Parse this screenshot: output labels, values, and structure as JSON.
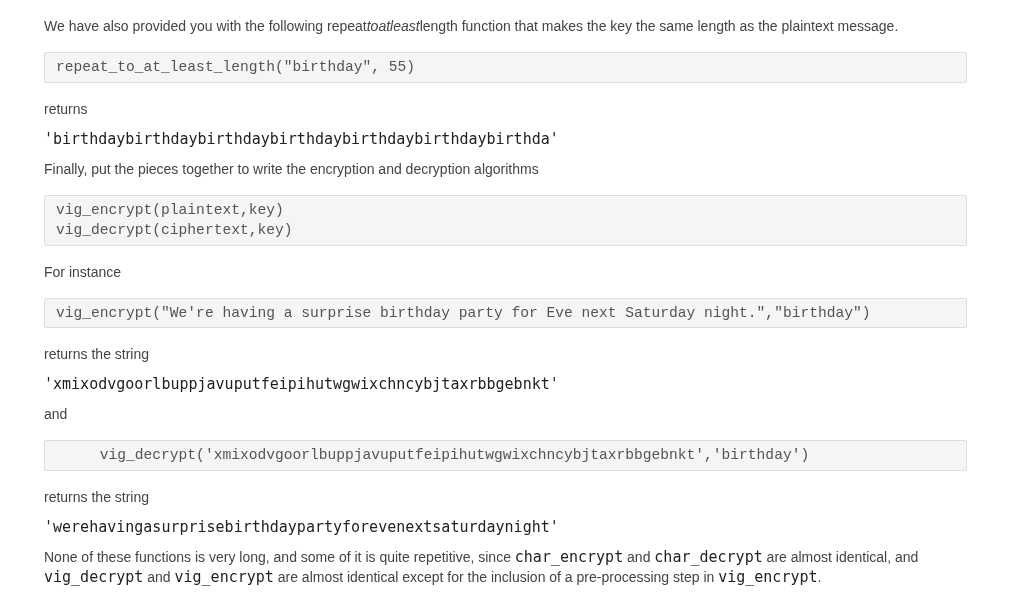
{
  "blocks": [
    {
      "kind": "paragraph",
      "segments": [
        {
          "kind": "text",
          "text": "We have also provided you with the following repeat"
        },
        {
          "kind": "italic",
          "text": "toatleast"
        },
        {
          "kind": "text",
          "text": "length function that makes the key the same length as the plaintext message."
        }
      ]
    },
    {
      "kind": "code_block",
      "lines": [
        "repeat_to_at_least_length(\"birthday\", 55)"
      ]
    },
    {
      "kind": "paragraph",
      "segments": [
        {
          "kind": "text",
          "text": "returns"
        }
      ]
    },
    {
      "kind": "output",
      "text": "'birthdaybirthdaybirthdaybirthdaybirthdaybirthdaybirthda'"
    },
    {
      "kind": "paragraph",
      "segments": [
        {
          "kind": "text",
          "text": "Finally, put the pieces together to write the encryption and decryption algorithms"
        }
      ]
    },
    {
      "kind": "code_block",
      "lines": [
        "vig_encrypt(plaintext,key)",
        "vig_decrypt(ciphertext,key)"
      ]
    },
    {
      "kind": "paragraph",
      "segments": [
        {
          "kind": "text",
          "text": "For instance"
        }
      ]
    },
    {
      "kind": "code_block",
      "lines": [
        "vig_encrypt(\"We're having a surprise birthday party for Eve next Saturday night.\",\"birthday\")"
      ]
    },
    {
      "kind": "paragraph",
      "segments": [
        {
          "kind": "text",
          "text": "returns the string"
        }
      ]
    },
    {
      "kind": "output",
      "text": "'xmixodvgoorlbuppjavuputfeipihutwgwixchncybjtaxrbbgebnkt'"
    },
    {
      "kind": "paragraph",
      "segments": [
        {
          "kind": "text",
          "text": "and"
        }
      ]
    },
    {
      "kind": "code_block",
      "lines": [
        "     vig_decrypt('xmixodvgoorlbuppjavuputfeipihutwgwixchncybjtaxrbbgebnkt','birthday')"
      ]
    },
    {
      "kind": "paragraph",
      "segments": [
        {
          "kind": "text",
          "text": "returns the string"
        }
      ]
    },
    {
      "kind": "output",
      "text": "'werehavingasurprisebirthdaypartyforevenextsaturdaynight'"
    },
    {
      "kind": "paragraph",
      "segments": [
        {
          "kind": "text",
          "text": "None of these functions is very long, and some of it is quite repetitive, since "
        },
        {
          "kind": "code",
          "text": "char_encrypt"
        },
        {
          "kind": "text",
          "text": " and "
        },
        {
          "kind": "code",
          "text": "char_decrypt"
        },
        {
          "kind": "text",
          "text": " are almost identical, and "
        },
        {
          "kind": "code",
          "text": "vig_decrypt"
        },
        {
          "kind": "text",
          "text": " and "
        },
        {
          "kind": "code",
          "text": "vig_encrypt"
        },
        {
          "kind": "text",
          "text": " are almost identical except for the inclusion of a pre-processing step in "
        },
        {
          "kind": "code",
          "text": "vig_encrypt"
        },
        {
          "kind": "text",
          "text": "."
        }
      ]
    }
  ]
}
